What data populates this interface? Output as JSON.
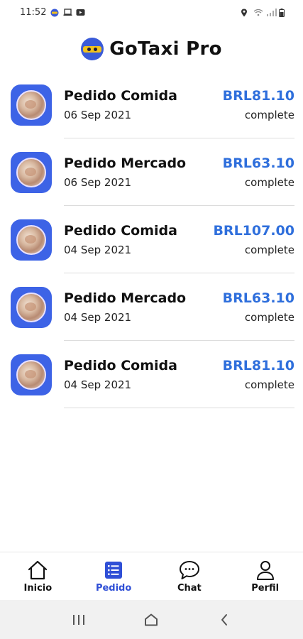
{
  "status_bar": {
    "time": "11:52",
    "icons_left": [
      "app-logo-icon",
      "laptop-icon",
      "youtube-icon"
    ],
    "icons_right": [
      "location-icon",
      "wifi-icon",
      "signal-icon",
      "battery-icon"
    ]
  },
  "header": {
    "title": "GoTaxi Pro",
    "logo_icon": "gotaxi-logo-icon"
  },
  "orders": [
    {
      "title": "Pedido Comida",
      "date": "06 Sep 2021",
      "price": "BRL81.10",
      "status": "complete"
    },
    {
      "title": "Pedido Mercado",
      "date": "06 Sep 2021",
      "price": "BRL63.10",
      "status": "complete"
    },
    {
      "title": "Pedido Comida",
      "date": "04 Sep 2021",
      "price": "BRL107.00",
      "status": "complete"
    },
    {
      "title": "Pedido Mercado",
      "date": "04 Sep 2021",
      "price": "BRL63.10",
      "status": "complete"
    },
    {
      "title": "Pedido Comida",
      "date": "04 Sep 2021",
      "price": "BRL81.10",
      "status": "complete"
    }
  ],
  "bottom_nav": {
    "items": [
      {
        "label": "Inicio",
        "icon": "home-icon",
        "active": false
      },
      {
        "label": "Pedido",
        "icon": "list-icon",
        "active": true
      },
      {
        "label": "Chat",
        "icon": "chat-icon",
        "active": false
      },
      {
        "label": "Perfil",
        "icon": "profile-icon",
        "active": false
      }
    ]
  },
  "colors": {
    "accent": "#2f4fd6",
    "price": "#2f6fdc",
    "avatar_bg": "#3d63e6"
  },
  "system_nav": {
    "buttons": [
      "recents-icon",
      "home-button-icon",
      "back-icon"
    ]
  }
}
